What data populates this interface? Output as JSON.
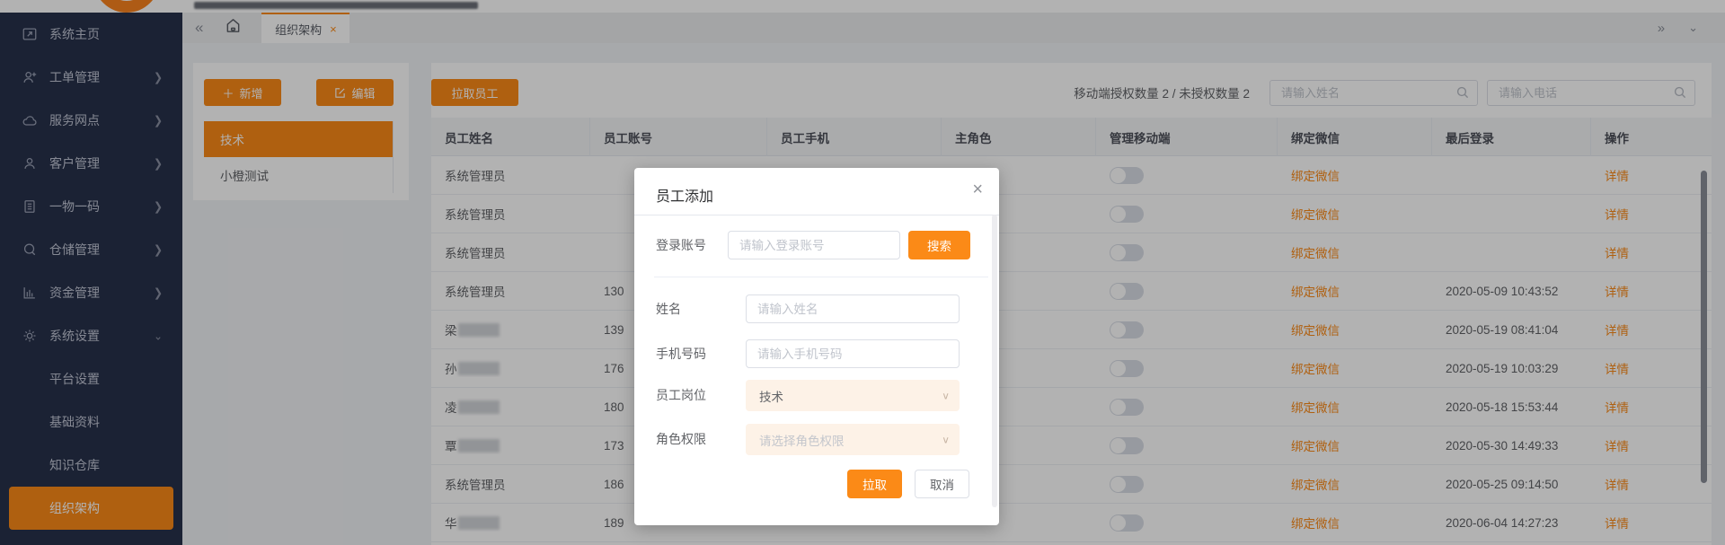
{
  "colors": {
    "accent": "#fb8a17",
    "sidebar_bg": "#28324b",
    "overlay": "rgba(0,0,0,0.30)"
  },
  "tabbar": {
    "active_tab": "组织架构"
  },
  "sidebar": {
    "items": [
      {
        "label": "系统主页",
        "icon": "screen-icon",
        "arrow": ""
      },
      {
        "label": "工单管理",
        "icon": "user-plus-icon",
        "arrow": "right"
      },
      {
        "label": "服务网点",
        "icon": "cloud-icon",
        "arrow": "right"
      },
      {
        "label": "客户管理",
        "icon": "user-icon",
        "arrow": "right"
      },
      {
        "label": "一物一码",
        "icon": "document-icon",
        "arrow": "right"
      },
      {
        "label": "仓储管理",
        "icon": "chat-icon",
        "arrow": "right"
      },
      {
        "label": "资金管理",
        "icon": "chart-icon",
        "arrow": "right"
      },
      {
        "label": "系统设置",
        "icon": "gear-icon",
        "arrow": "down"
      }
    ],
    "submenu": [
      {
        "label": "平台设置",
        "active": false
      },
      {
        "label": "基础资料",
        "active": false
      },
      {
        "label": "知识仓库",
        "active": false
      },
      {
        "label": "组织架构",
        "active": true
      }
    ]
  },
  "tree_panel": {
    "add_button": "新增",
    "edit_button": "编辑",
    "nodes": [
      {
        "label": "技术",
        "selected": true
      },
      {
        "label": "小橙测试",
        "selected": false
      }
    ]
  },
  "toolbar": {
    "pull_button": "拉取员工",
    "stats": "移动端授权数量 2 / 未授权数量 2",
    "search_name_placeholder": "请输入姓名",
    "search_phone_placeholder": "请输入电话"
  },
  "table": {
    "headers": [
      "员工姓名",
      "员工账号",
      "员工手机",
      "主角色",
      "管理移动端",
      "绑定微信",
      "最后登录",
      "操作"
    ],
    "wechat_link": "绑定微信",
    "detail_link": "详情",
    "rows": [
      {
        "name": "系统管理员",
        "masked": false,
        "account": "",
        "last_login": ""
      },
      {
        "name": "系统管理员",
        "masked": false,
        "account": "",
        "last_login": ""
      },
      {
        "name": "系统管理员",
        "masked": false,
        "account": "",
        "last_login": ""
      },
      {
        "name": "系统管理员",
        "masked": false,
        "account": "130",
        "last_login": "2020-05-09 10:43:52"
      },
      {
        "name": "梁",
        "masked": true,
        "account": "139",
        "last_login": "2020-05-19 08:41:04"
      },
      {
        "name": "孙",
        "masked": true,
        "account": "176",
        "last_login": "2020-05-19 10:03:29"
      },
      {
        "name": "凌",
        "masked": true,
        "account": "180",
        "last_login": "2020-05-18 15:53:44"
      },
      {
        "name": "覃",
        "masked": true,
        "account": "173",
        "last_login": "2020-05-30 14:49:33"
      },
      {
        "name": "系统管理员",
        "masked": false,
        "account": "186",
        "last_login": "2020-05-25 09:14:50"
      },
      {
        "name": "华",
        "masked": true,
        "account": "189",
        "last_login": "2020-06-04 14:27:23"
      }
    ]
  },
  "modal": {
    "title": "员工添加",
    "login_label": "登录账号",
    "login_placeholder": "请输入登录账号",
    "search_button": "搜索",
    "name_label": "姓名",
    "name_placeholder": "请输入姓名",
    "phone_label": "手机号码",
    "phone_placeholder": "请输入手机号码",
    "post_label": "员工岗位",
    "post_value": "技术",
    "role_label": "角色权限",
    "role_placeholder": "请选择角色权限",
    "pull_button": "拉取",
    "cancel_button": "取消"
  }
}
